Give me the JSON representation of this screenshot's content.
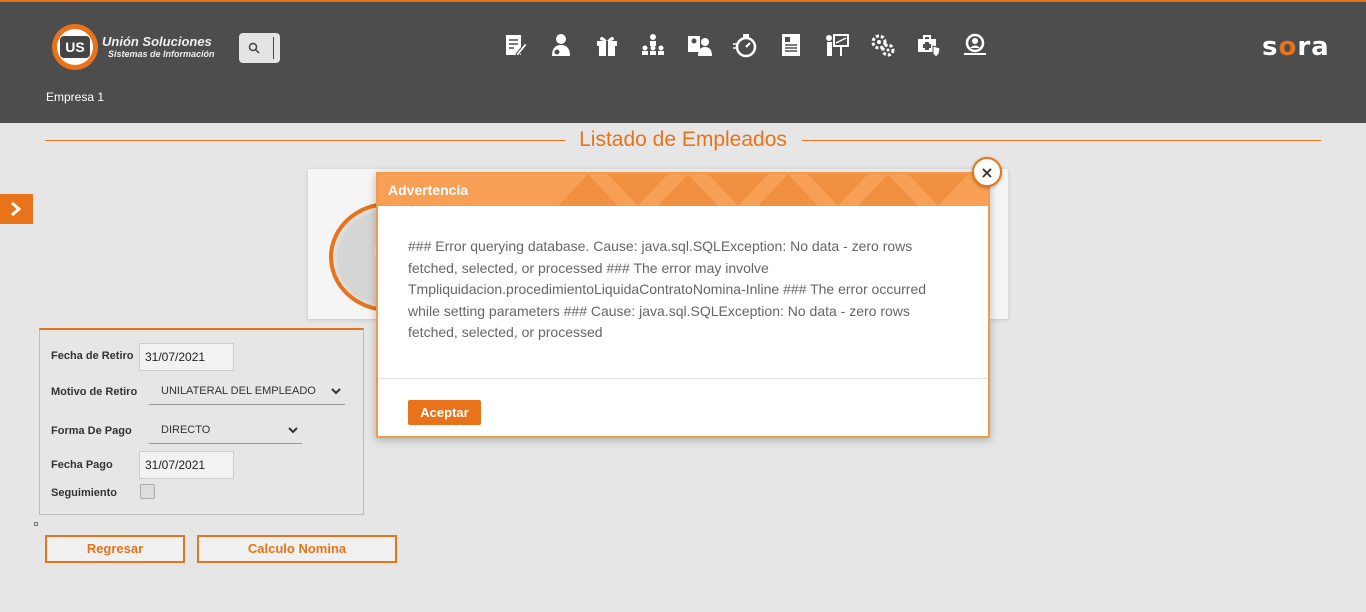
{
  "header": {
    "logo_name": "Unión Soluciones",
    "logo_sub": "Sistemas de Información",
    "logo_mark": "US",
    "brand": "sora",
    "company": "Empresa 1",
    "nav_icons": [
      "document-edit-icon",
      "employee-icon",
      "gift-icon",
      "org-chart-icon",
      "id-card-icon",
      "stopwatch-icon",
      "report-icon",
      "presentation-icon",
      "gears-icon",
      "medical-kit-icon",
      "search-user-icon"
    ]
  },
  "page": {
    "title": "Listado de Empleados"
  },
  "form": {
    "fecha_retiro_label": "Fecha de Retiro",
    "fecha_retiro_value": "31/07/2021",
    "motivo_label": "Motivo de Retiro",
    "motivo_value": "UNILATERAL DEL EMPLEADO",
    "forma_pago_label": "Forma De Pago",
    "forma_pago_value": "DIRECTO",
    "fecha_pago_label": "Fecha Pago",
    "fecha_pago_value": "31/07/2021",
    "seguimiento_label": "Seguimiento"
  },
  "buttons": {
    "back": "Regresar",
    "calc": "Calculo Nomina"
  },
  "modal": {
    "title": "Advertencia",
    "message": "### Error querying database. Cause: java.sql.SQLException: No data - zero rows fetched, selected, or processed ### The error may involve Tmpliquidacion.procedimientoLiquidaContratoNomina-Inline ### The error occurred while setting parameters ### Cause: java.sql.SQLException: No data - zero rows fetched, selected, or processed",
    "accept": "Aceptar",
    "close": "×"
  },
  "colors": {
    "accent": "#e8731a",
    "header_bg": "#4d4d4d",
    "modal_header": "#f7a055"
  }
}
